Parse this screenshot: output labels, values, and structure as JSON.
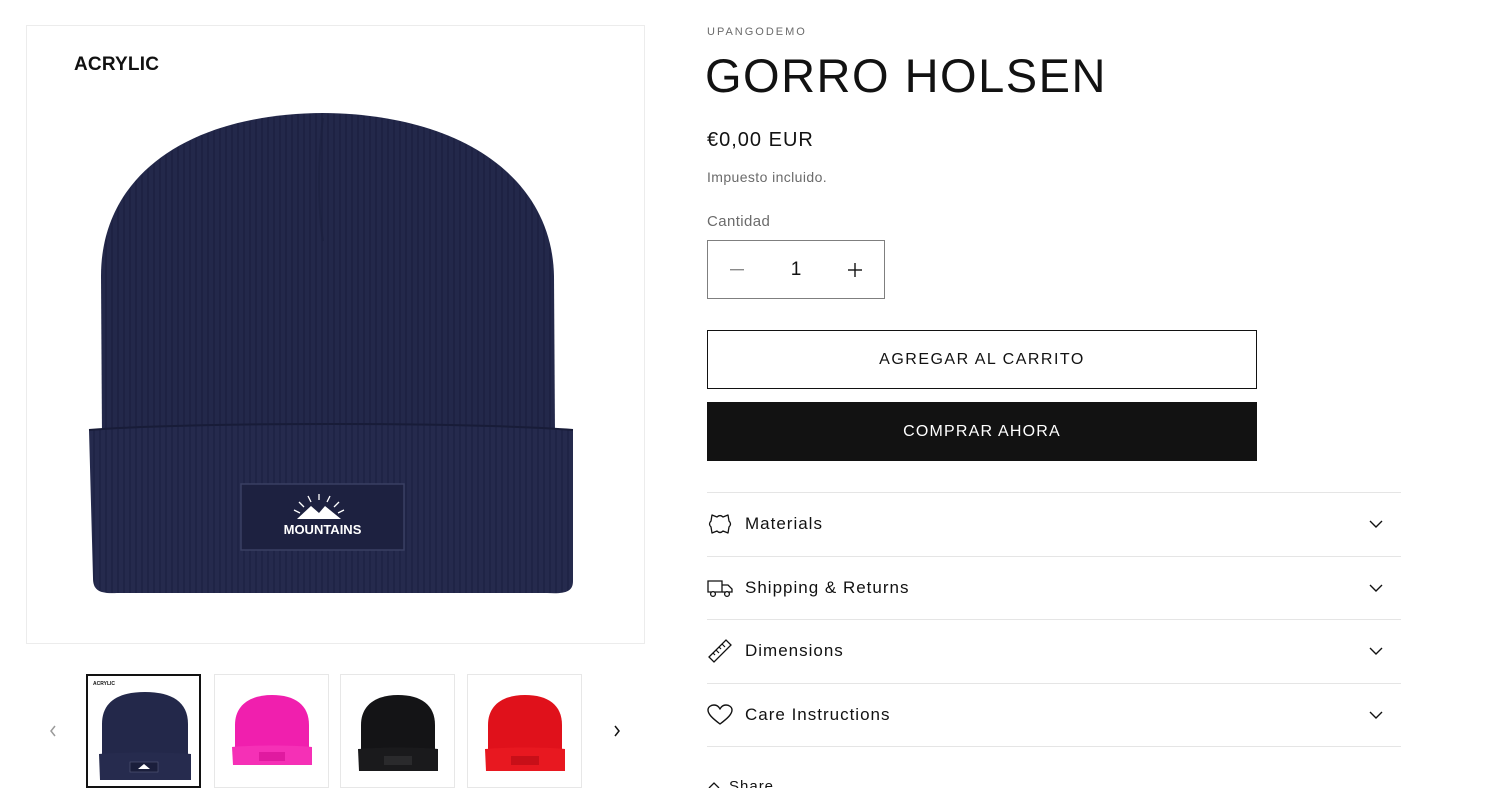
{
  "gallery": {
    "main_image_label": "ACRYLIC",
    "patch_text": "MOUNTAINS",
    "thumb_label": "ACRYLIC",
    "thumbnails": [
      {
        "color": "#23284a",
        "name": "navy"
      },
      {
        "color": "#f31fb0",
        "name": "pink"
      },
      {
        "color": "#121214",
        "name": "black"
      },
      {
        "color": "#e0111b",
        "name": "red"
      }
    ]
  },
  "product": {
    "vendor": "UPANGODEMO",
    "title": "GORRO HOLSEN",
    "price": "€0,00 EUR",
    "tax_note": "Impuesto incluido.",
    "quantity_label": "Cantidad",
    "quantity_value": "1",
    "add_to_cart": "AGREGAR AL CARRITO",
    "buy_now": "COMPRAR AHORA"
  },
  "accordion": [
    {
      "label": "Materials",
      "icon": "leather-icon"
    },
    {
      "label": "Shipping & Returns",
      "icon": "truck-icon"
    },
    {
      "label": "Dimensions",
      "icon": "ruler-icon"
    },
    {
      "label": "Care Instructions",
      "icon": "heart-icon"
    }
  ],
  "share": {
    "label": "Share",
    "icon": "share-icon"
  },
  "colors": {
    "text": "#121212",
    "muted": "#6b6b6b",
    "border": "#e5e5e5",
    "button_dark": "#121212",
    "beanie_navy": "#23284a"
  }
}
